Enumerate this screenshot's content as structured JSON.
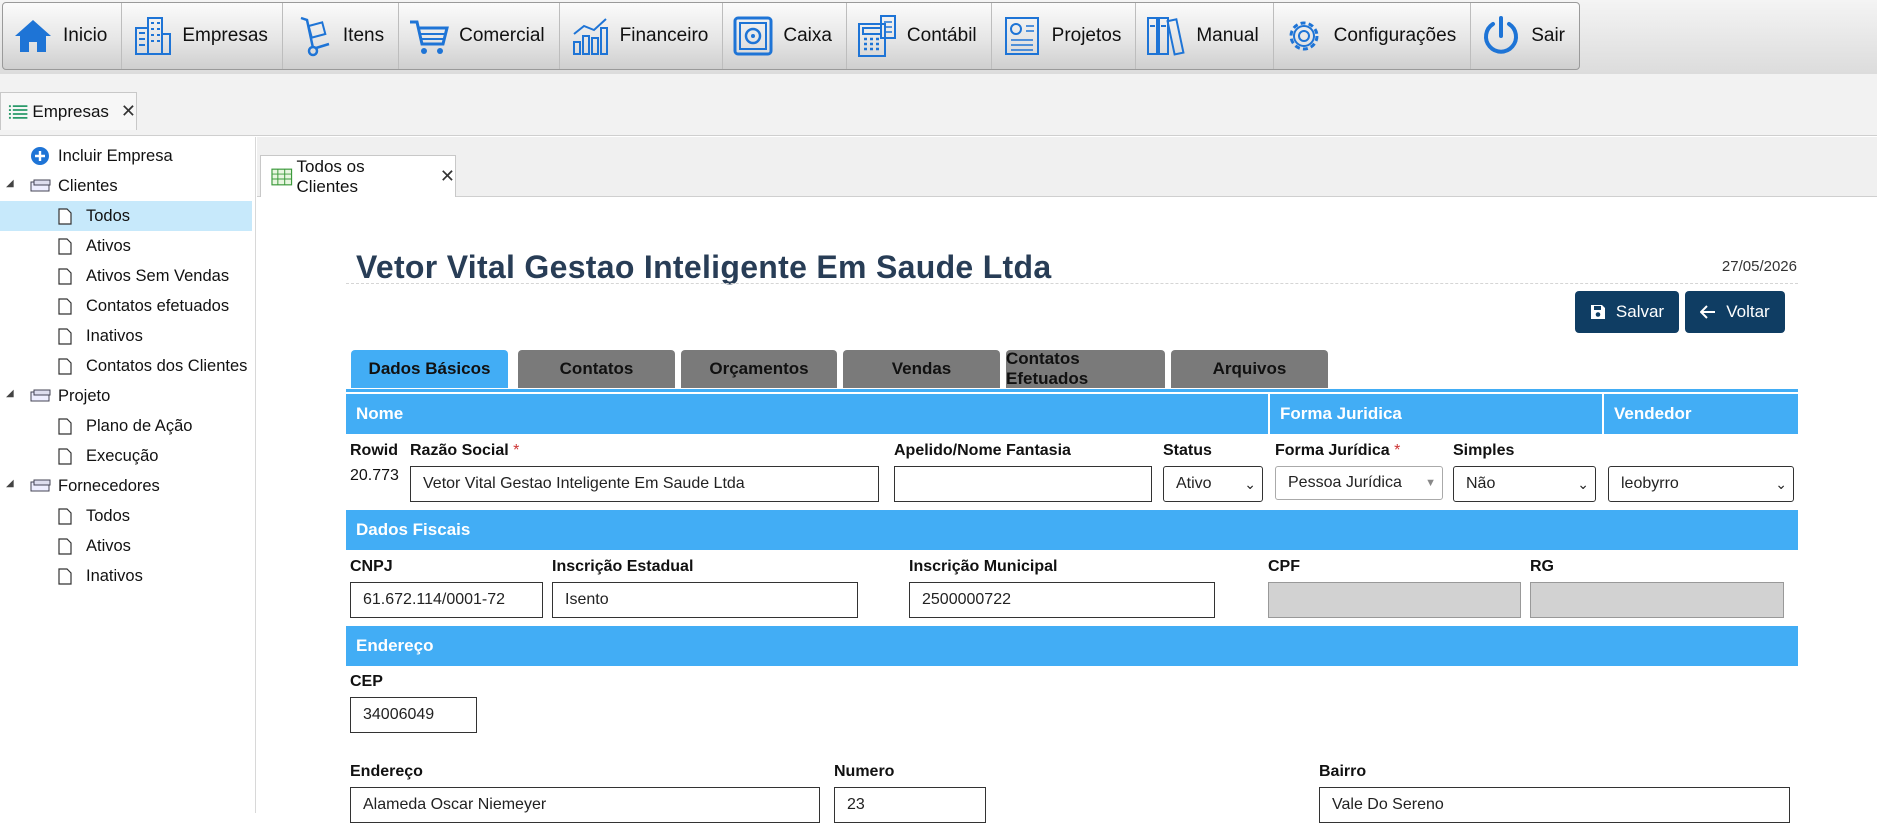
{
  "menu": [
    {
      "label": "Inicio",
      "icon": "home-icon"
    },
    {
      "label": "Empresas",
      "icon": "buildings-icon"
    },
    {
      "label": "Itens",
      "icon": "hand-truck-icon"
    },
    {
      "label": "Comercial",
      "icon": "cart-icon"
    },
    {
      "label": "Financeiro",
      "icon": "bar-chart-icon"
    },
    {
      "label": "Caixa",
      "icon": "safe-icon"
    },
    {
      "label": "Contábil",
      "icon": "calculator-icon"
    },
    {
      "label": "Projetos",
      "icon": "report-icon"
    },
    {
      "label": "Manual",
      "icon": "binders-icon"
    },
    {
      "label": "Configurações",
      "icon": "gear-icon"
    },
    {
      "label": "Sair",
      "icon": "power-icon"
    }
  ],
  "outer_tab": {
    "label": "Empresas"
  },
  "tree": {
    "add_company": "Incluir Empresa",
    "clients": "Clientes",
    "clients_children": [
      "Todos",
      "Ativos",
      "Ativos Sem Vendas",
      "Contatos efetuados",
      "Inativos",
      "Contatos dos Clientes"
    ],
    "project": "Projeto",
    "project_children": [
      "Plano de Ação",
      "Execução"
    ],
    "suppliers": "Fornecedores",
    "suppliers_children": [
      "Todos",
      "Ativos",
      "Inativos"
    ]
  },
  "inner_tab": {
    "label": "Todos os Clientes"
  },
  "record": {
    "title": "Vetor Vital Gestao Inteligente Em Saude Ltda",
    "date": "27/05/2026"
  },
  "buttons": {
    "save": "Salvar",
    "back": "Voltar"
  },
  "form_tabs": [
    "Dados Básicos",
    "Contatos",
    "Orçamentos",
    "Vendas",
    "Contatos Efetuados",
    "Arquivos"
  ],
  "sections": {
    "nome": "Nome",
    "forma_juridica": "Forma Juridica",
    "vendedor": "Vendedor",
    "fiscais": "Dados Fiscais",
    "endereco": "Endereço"
  },
  "fields": {
    "rowid": {
      "label": "Rowid",
      "value": "20.773"
    },
    "razao": {
      "label": "Razão Social",
      "value": "Vetor Vital Gestao Inteligente Em Saude Ltda"
    },
    "apelido": {
      "label": "Apelido/Nome Fantasia",
      "value": ""
    },
    "status": {
      "label": "Status",
      "value": "Ativo"
    },
    "forma": {
      "label": "Forma Jurídica",
      "value": "Pessoa Jurídica"
    },
    "simples": {
      "label": "Simples",
      "value": "Não"
    },
    "vendedor": {
      "value": "leobyrro"
    },
    "cnpj": {
      "label": "CNPJ",
      "value": "61.672.114/0001-72"
    },
    "ie": {
      "label": "Inscrição Estadual",
      "value": "Isento"
    },
    "im": {
      "label": "Inscrição Municipal",
      "value": "2500000722"
    },
    "cpf": {
      "label": "CPF",
      "value": ""
    },
    "rg": {
      "label": "RG",
      "value": ""
    },
    "cep": {
      "label": "CEP",
      "value": "34006049"
    },
    "endereco": {
      "label": "Endereço",
      "value": "Alameda Oscar Niemeyer"
    },
    "numero": {
      "label": "Numero",
      "value": "23"
    },
    "bairro": {
      "label": "Bairro",
      "value": "Vale Do Sereno"
    }
  },
  "required_mark": "*",
  "colors": {
    "menu_icon": "#1e74d6",
    "accent": "#42adf5",
    "button": "#0f3d63",
    "title": "#283d56",
    "selected_node": "#c7e9fb"
  }
}
